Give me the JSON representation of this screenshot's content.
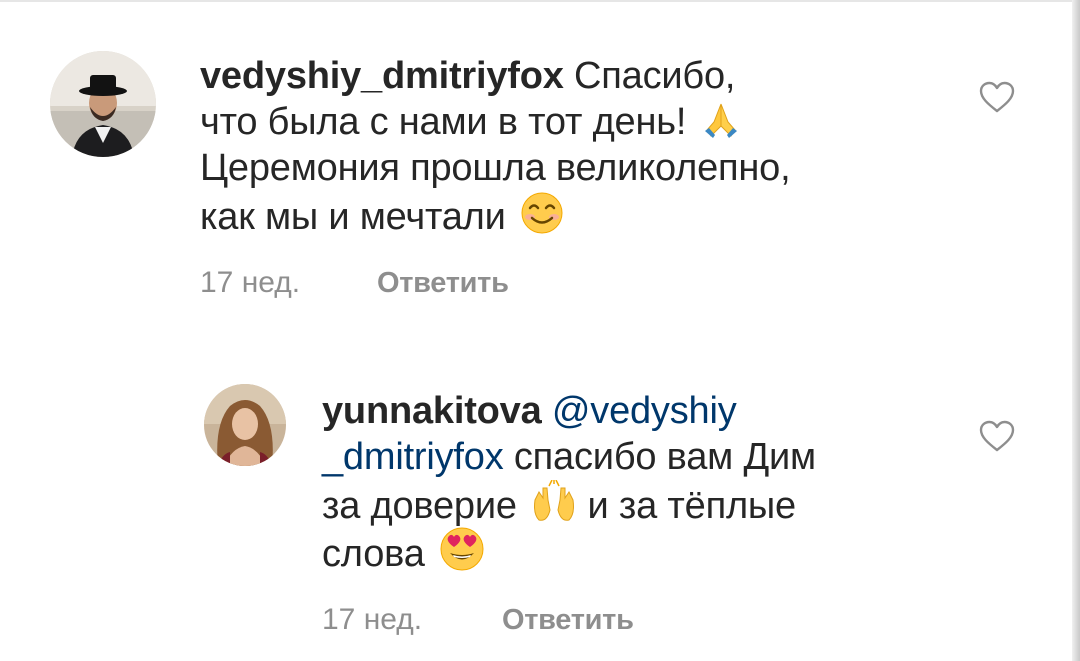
{
  "comments": [
    {
      "username": "vedyshiy_dmitriyfox",
      "lines": [
        "Спасибо,",
        "что была с нами в тот день!",
        "Церемония прошла великолепно,",
        "как мы и мечтали"
      ],
      "emojis": [
        "folded-hands",
        "smiling-face"
      ],
      "time": "17 нед.",
      "reply_label": "Ответить"
    },
    {
      "username": "yunnakitova",
      "mention_part1": "@vedyshiy",
      "mention_part2": "_dmitriyfox",
      "lines": [
        "спасибо вам Дим",
        "за доверие",
        "и за тёплые",
        "слова"
      ],
      "emojis": [
        "raising-hands",
        "heart-eyes-face"
      ],
      "time": "17 нед.",
      "reply_label": "Ответить"
    }
  ],
  "colors": {
    "text": "#262626",
    "meta": "#8e8e8e",
    "mention": "#00376b",
    "heart_outline": "#8e8e8e"
  }
}
